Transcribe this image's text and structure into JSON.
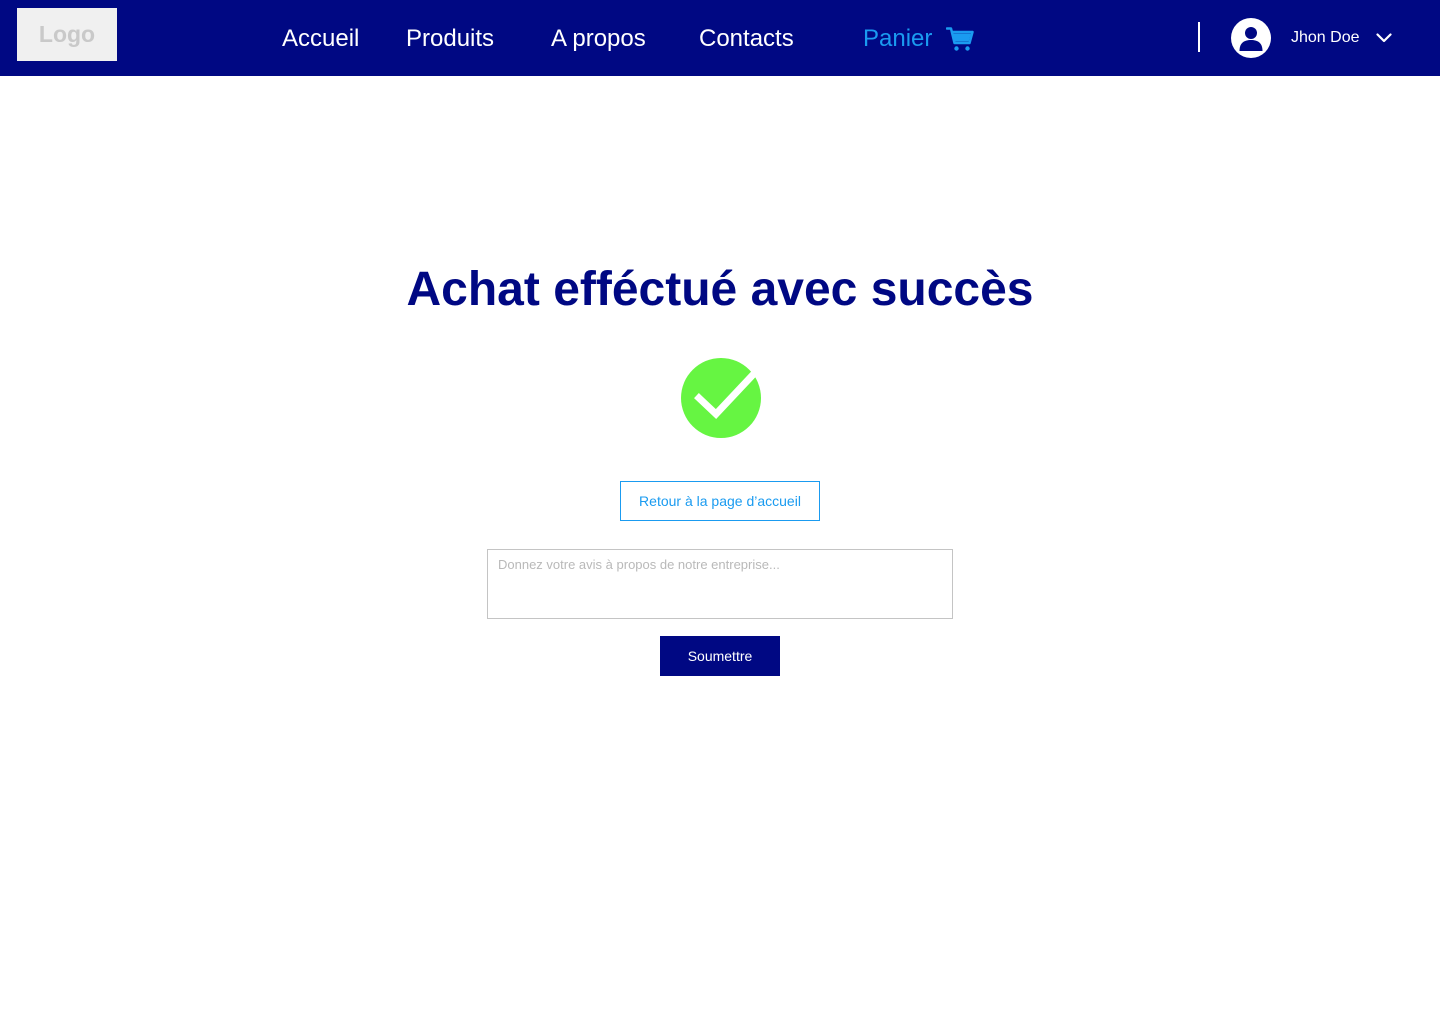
{
  "header": {
    "logo_text": "Logo",
    "nav": {
      "home": "Accueil",
      "products": "Produits",
      "about": "A propos",
      "contacts": "Contacts",
      "cart": "Panier"
    },
    "user": {
      "name": "Jhon Doe",
      "avatar_icon": "user-avatar-icon",
      "menu_icon": "chevron-down-icon"
    },
    "cart_icon": "shopping-cart-icon"
  },
  "main": {
    "title": "Achat efféctué avec succès",
    "success_icon": "check-circle-icon",
    "home_button_label": "Retour à la page d’accueil",
    "feedback": {
      "placeholder": "Donnez votre avis à propos de notre entreprise...",
      "value": ""
    },
    "submit_label": "Soumettre"
  },
  "colors": {
    "navbar": "#000883",
    "accent": "#1a9bf0",
    "success": "#66f542",
    "title": "#000883"
  }
}
